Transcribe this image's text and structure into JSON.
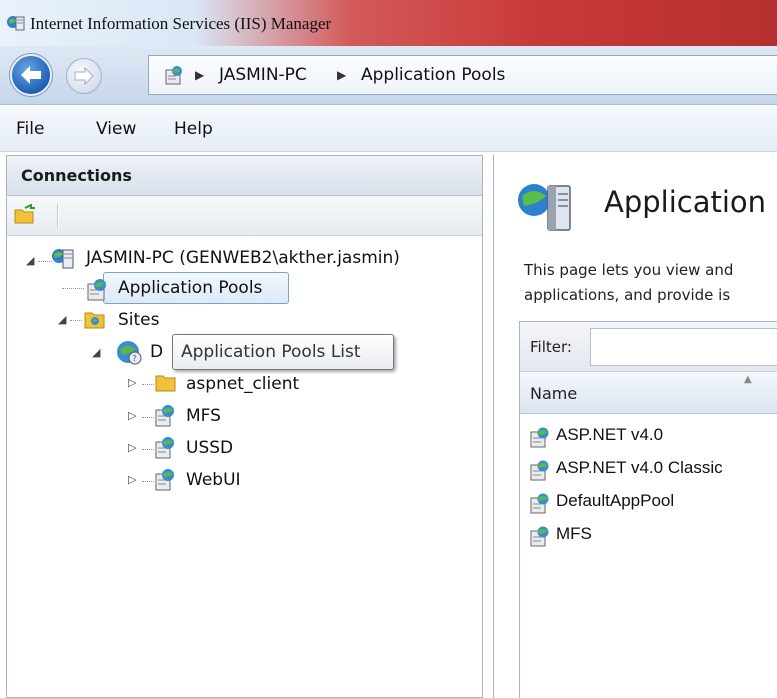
{
  "window": {
    "title": "Internet Information Services (IIS) Manager"
  },
  "address": {
    "crumbs": [
      "JASMIN-PC",
      "Application Pools"
    ]
  },
  "menu": {
    "items": [
      "File",
      "View",
      "Help"
    ]
  },
  "connections": {
    "header": "Connections",
    "tree": {
      "server": "JASMIN-PC (GENWEB2\\akther.jasmin)",
      "app_pools": "Application Pools",
      "sites": "Sites",
      "default_site_partial": "D",
      "children": [
        "aspnet_client",
        "MFS",
        "USSD",
        "WebUI"
      ]
    },
    "tooltip": "Application Pools List"
  },
  "content": {
    "title": "Application",
    "desc_line1": "This page lets you view and",
    "desc_line2": "applications, and provide is",
    "filter_label": "Filter:",
    "column_name": "Name",
    "pools": [
      "ASP.NET v4.0",
      "ASP.NET v4.0 Classic",
      "DefaultAppPool",
      "MFS"
    ]
  }
}
